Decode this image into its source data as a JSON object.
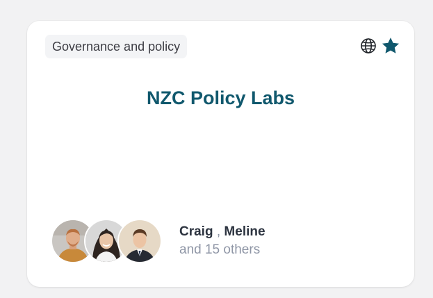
{
  "card": {
    "tag": "Governance and policy",
    "title": "NZC Policy Labs",
    "icons": {
      "globe": "globe-icon",
      "star": "star-icon"
    },
    "members": {
      "names": [
        "Craig",
        "Meline"
      ],
      "separator": ",",
      "others": "and 15 others"
    }
  },
  "colors": {
    "accent": "#10586d",
    "tag_bg": "#f3f4f6",
    "card_bg": "#ffffff",
    "page_bg": "#f2f2f3"
  }
}
